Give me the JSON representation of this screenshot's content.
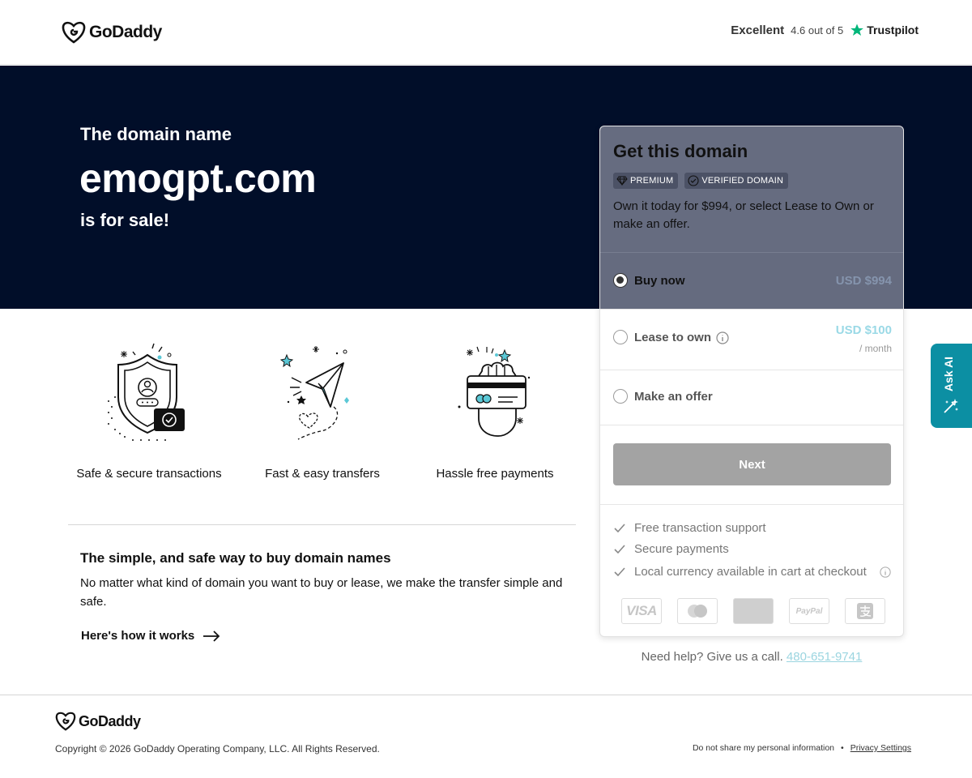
{
  "header": {
    "logo_text": "GoDaddy",
    "rating_label": "Excellent",
    "rating_score": "4.6 out of 5",
    "trustpilot": "Trustpilot"
  },
  "hero": {
    "lead": "The domain name",
    "domain": "emogpt.com",
    "for_sale": "is for sale!"
  },
  "card": {
    "title": "Get this domain",
    "badges": [
      "PREMIUM",
      "VERIFIED DOMAIN"
    ],
    "description": "Own it today for $994, or select Lease to Own or make an offer.",
    "options": [
      {
        "label": "Buy now",
        "price": "USD $994",
        "selected": true
      },
      {
        "label": "Lease to own",
        "price": "USD $100",
        "period": "/ month",
        "selected": false
      },
      {
        "label": "Make an offer",
        "selected": false
      }
    ],
    "next_label": "Next",
    "features": [
      "Free transaction support",
      "Secure payments",
      "Local currency available in cart at checkout"
    ],
    "payment_methods": [
      "VISA",
      "Mastercard",
      "American Express",
      "PayPal",
      "Alipay"
    ]
  },
  "help": {
    "text": "Need help? Give us a call.",
    "phone": "480-651-9741"
  },
  "features": [
    {
      "label": "Safe & secure transactions"
    },
    {
      "label": "Fast & easy transfers"
    },
    {
      "label": "Hassle free payments"
    }
  ],
  "info": {
    "title": "The simple, and safe way to buy domain names",
    "description": "No matter what kind of domain you want to buy or lease, we make the transfer simple and safe.",
    "link": "Here's how it works"
  },
  "ask_ai": {
    "label": "Ask AI"
  },
  "footer": {
    "logo_text": "GoDaddy",
    "copyright": "Copyright © 2026 GoDaddy Operating Company, LLC. All Rights Reserved.",
    "dnsmpi": "Do not share my personal information",
    "separator": "•",
    "privacy": "Privacy Settings"
  },
  "colors": {
    "hero_bg": "#010e29",
    "card_overlay": "#666c80",
    "accent_teal": "#0c8fa3",
    "link_teal": "#9bd5e0"
  }
}
